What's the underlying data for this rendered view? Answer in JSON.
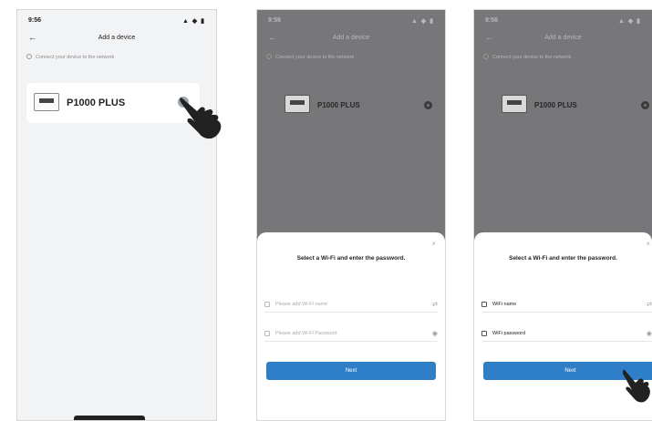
{
  "status_bar": {
    "time": "9:56",
    "signal": "▲ ◆ ▮"
  },
  "nav": {
    "back_label": "←",
    "title": "Add a device"
  },
  "hint": {
    "text": "Connect your device to the network"
  },
  "device": {
    "name": "P1000 PLUS"
  },
  "wifi_sheet": {
    "close_label": "×",
    "title": "Select a Wi-Fi and enter the password.",
    "screen2": {
      "wifi_name_placeholder": "Please add Wi-Fi name",
      "wifi_password_placeholder": "Please add Wi-Fi Password",
      "wifi_arrow": "⇄",
      "eye_icon_glyph": "◉"
    },
    "screen3": {
      "wifi_name_value": "WiFi name",
      "wifi_password_value": "WiFi password",
      "wifi_arrow": "⇄",
      "eye_icon_glyph": "◉"
    },
    "next_label": "Next"
  },
  "icons": [
    "info-icon",
    "back-arrow-icon",
    "gear-icon",
    "wifi-icon",
    "lock-icon",
    "eye-icon",
    "pointing-hand-icon"
  ],
  "colors": {
    "accent": "#2f7fc8",
    "overlay": "#777779",
    "background": "#f2f3f5"
  }
}
